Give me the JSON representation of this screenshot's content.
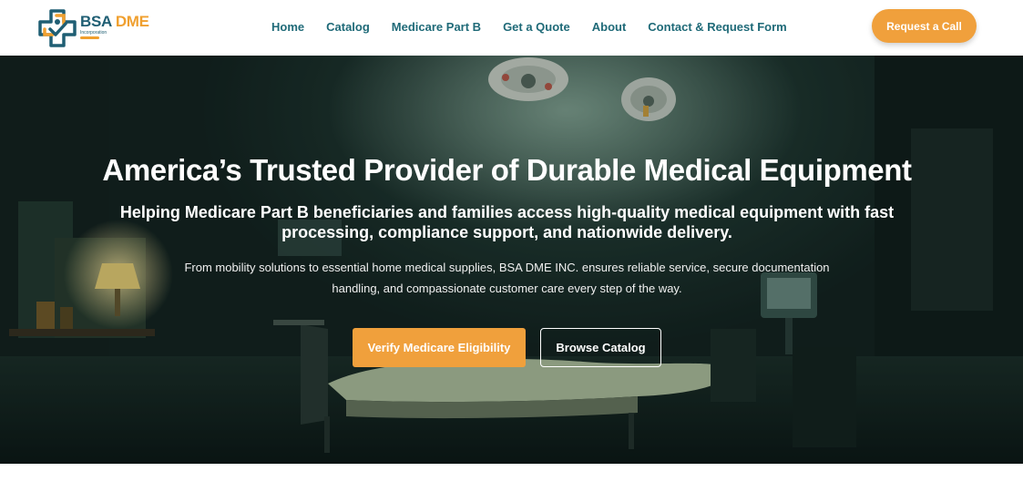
{
  "brand": {
    "name_primary": "BSA",
    "name_accent": "DME",
    "tagline": "Incorporation"
  },
  "nav": {
    "items": [
      {
        "label": "Home"
      },
      {
        "label": "Catalog"
      },
      {
        "label": "Medicare Part B"
      },
      {
        "label": "Get a Quote"
      },
      {
        "label": "About"
      },
      {
        "label": "Contact & Request Form"
      }
    ]
  },
  "header": {
    "cta_label": "Request a Call"
  },
  "hero": {
    "title": "America’s Trusted Provider of Durable Medical Equipment",
    "subtitle": "Helping Medicare Part B beneficiaries and families access high-quality medical equipment with fast processing, compliance support, and nationwide delivery.",
    "description": "From mobility solutions to essential home medical supplies, BSA DME INC. ensures reliable service, secure documentation handling, and compassionate customer care every step of the way.",
    "primary_button": "Verify Medicare Eligibility",
    "secondary_button": "Browse Catalog"
  },
  "colors": {
    "brand_teal": "#1f6a78",
    "accent_orange": "#f0a03c",
    "hero_dark": "#14221f"
  }
}
